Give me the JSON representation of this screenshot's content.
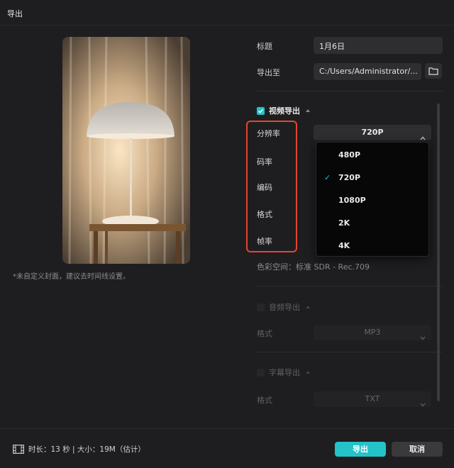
{
  "window": {
    "title": "导出"
  },
  "preview": {
    "note": "*未自定义封面，建议去时间线设置。"
  },
  "form": {
    "title_label": "标题",
    "title_value": "1月6日",
    "path_label": "导出至",
    "path_value": "C:/Users/Administrator/..."
  },
  "video": {
    "section_label": "视频导出",
    "resolution_label": "分辨率",
    "resolution_value": "720P",
    "bitrate_label": "码率",
    "codec_label": "编码",
    "format_label": "格式",
    "framerate_label": "帧率",
    "resolution_options": [
      "480P",
      "720P",
      "1080P",
      "2K",
      "4K"
    ],
    "selected_option": "720P",
    "colorspace": "色彩空间：标准 SDR - Rec.709"
  },
  "audio": {
    "section_label": "音频导出",
    "format_label": "格式",
    "format_value": "MP3"
  },
  "subtitle": {
    "section_label": "字幕导出",
    "format_label": "格式",
    "format_value": "TXT"
  },
  "footer": {
    "info": "时长：13 秒 | 大小：19M（估计）",
    "export_button": "导出",
    "cancel_button": "取消"
  },
  "colors": {
    "accent": "#23c3c8",
    "highlight": "#e5452f",
    "background": "#1e1e20"
  },
  "icons": {
    "folder": "folder-icon",
    "film": "film-icon",
    "check": "check-icon"
  }
}
